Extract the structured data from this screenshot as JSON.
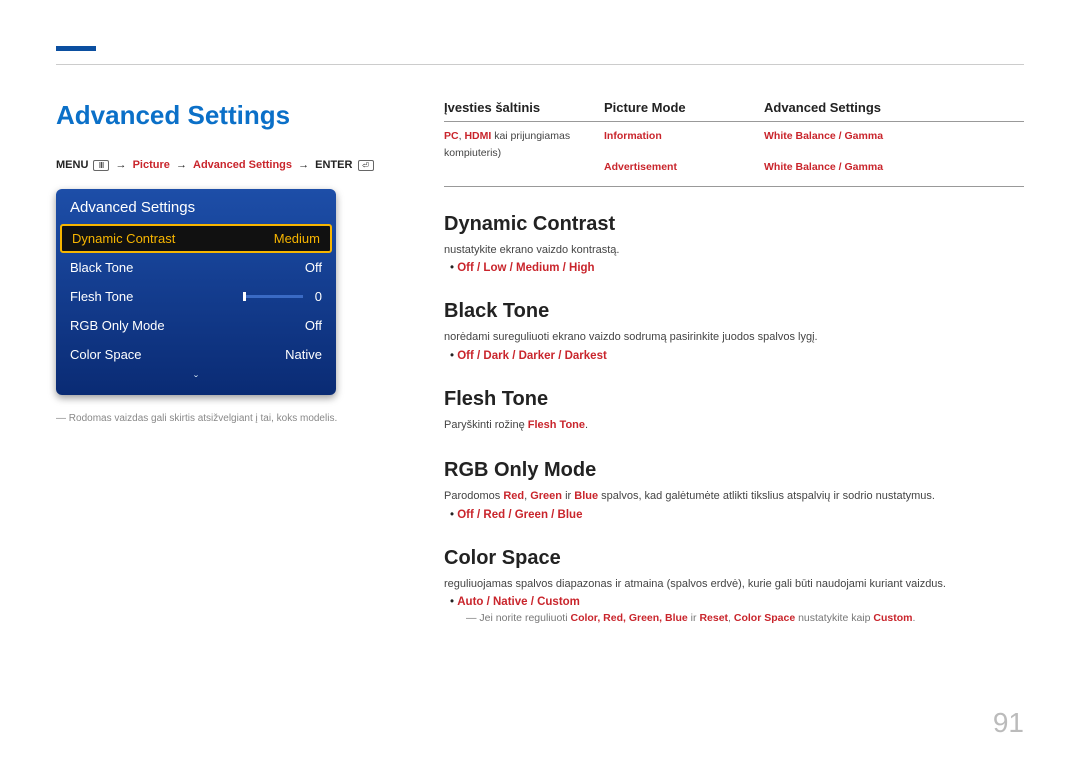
{
  "page_number": "91",
  "title": "Advanced Settings",
  "breadcrumb": {
    "menu": "MENU",
    "path1": "Picture",
    "path2": "Advanced Settings",
    "enter": "ENTER"
  },
  "tvmenu": {
    "title": "Advanced Settings",
    "rows": [
      {
        "label": "Dynamic Contrast",
        "value": "Medium",
        "selected": true
      },
      {
        "label": "Black Tone",
        "value": "Off"
      },
      {
        "label": "Flesh Tone",
        "value": "0",
        "slider": true
      },
      {
        "label": "RGB Only Mode",
        "value": "Off"
      },
      {
        "label": "Color Space",
        "value": "Native"
      }
    ]
  },
  "footnote": "Rodomas vaizdas gali skirtis atsižvelgiant į tai, koks modelis.",
  "table": {
    "headers": [
      "Įvesties šaltinis",
      "Picture Mode",
      "Advanced Settings"
    ],
    "r1c1_a": "PC",
    "r1c1_b": "HDMI",
    "r1c1_rest": " kai prijungiamas kompiuteris)",
    "r1c2": "Information",
    "r1c3": "White Balance / Gamma",
    "r2c2": "Advertisement",
    "r2c3": "White Balance / Gamma"
  },
  "sections": {
    "dynamic_contrast": {
      "title": "Dynamic Contrast",
      "desc": "nustatykite ekrano vaizdo kontrastą.",
      "options": "Off / Low / Medium / High"
    },
    "black_tone": {
      "title": "Black Tone",
      "desc": "norėdami sureguliuoti ekrano vaizdo sodrumą pasirinkite juodos spalvos lygį.",
      "options": "Off / Dark / Darker / Darkest"
    },
    "flesh_tone": {
      "title": "Flesh Tone",
      "desc_pre": "Paryškinti rožinę ",
      "desc_red": "Flesh Tone",
      "desc_post": "."
    },
    "rgb_only": {
      "title": "RGB Only Mode",
      "desc_pre": "Parodomos ",
      "r": "Red",
      "g": "Green",
      "b": "Blue",
      "desc_post": " spalvos, kad galėtumėte atlikti tikslius atspalvių ir sodrio nustatymus.",
      "options": "Off / Red / Green / Blue"
    },
    "color_space": {
      "title": "Color Space",
      "desc": "reguliuojamas spalvos diapazonas ir atmaina (spalvos erdvė), kurie gali būti naudojami kuriant vaizdus.",
      "options": "Auto / Native / Custom",
      "note_pre": "Jei norite reguliuoti ",
      "note_items": "Color, Red, Green, Blue",
      "note_mid": " ir ",
      "note_reset": "Reset",
      "note_cs": "Color Space",
      "note_post": " nustatykite kaip ",
      "note_custom": "Custom",
      "note_end": "."
    }
  }
}
